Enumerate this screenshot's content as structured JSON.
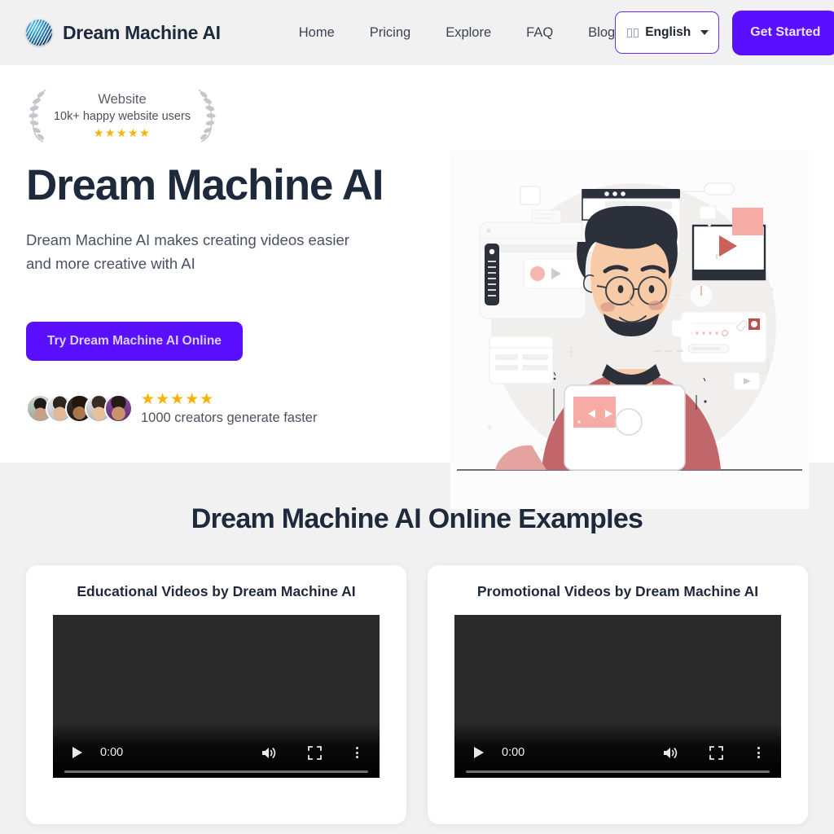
{
  "header": {
    "brand_name": "Dream Machine AI",
    "logo_icon": "dream-machine-sphere-logo",
    "nav": [
      {
        "label": "Home"
      },
      {
        "label": "Pricing"
      },
      {
        "label": "Explore"
      },
      {
        "label": "FAQ"
      },
      {
        "label": "Blog"
      }
    ],
    "language": {
      "label": "English",
      "flag_glyph": "⬜⬜",
      "chevron_icon": "chevron-down-icon"
    },
    "cta_label": "Get Started",
    "background": "#F1F1F1",
    "accent_color": "#5B0FFF"
  },
  "hero": {
    "award": {
      "title": "Website",
      "subtitle": "10k+ happy website users",
      "stars": "★★★★★",
      "rating": 5,
      "left_icon": "laurel-wreath-left-icon",
      "right_icon": "laurel-wreath-right-icon",
      "star_color": "#F4B400"
    },
    "title": "Dream Machine AI",
    "subtitle": "Dream Machine AI makes creating videos easier and more creative with AI",
    "cta_label": "Try Dream Machine AI Online",
    "social_proof": {
      "stars": "★★★★★",
      "rating": 5,
      "label": "1000 creators generate faster",
      "avatar_count": 5
    },
    "illustration_name": "creator-at-laptop-illustration"
  },
  "examples": {
    "heading": "Dream Machine AI Online Examples",
    "background": "#F1F1F1",
    "cards": [
      {
        "title": "Educational Videos by Dream Machine AI",
        "video": {
          "time": "0:00",
          "play_icon": "play-icon",
          "volume_icon": "volume-icon",
          "fullscreen_icon": "fullscreen-icon",
          "more_icon": "more-options-icon"
        }
      },
      {
        "title": "Promotional Videos by Dream Machine AI",
        "video": {
          "time": "0:00",
          "play_icon": "play-icon",
          "volume_icon": "volume-icon",
          "fullscreen_icon": "fullscreen-icon",
          "more_icon": "more-options-icon"
        }
      }
    ]
  }
}
